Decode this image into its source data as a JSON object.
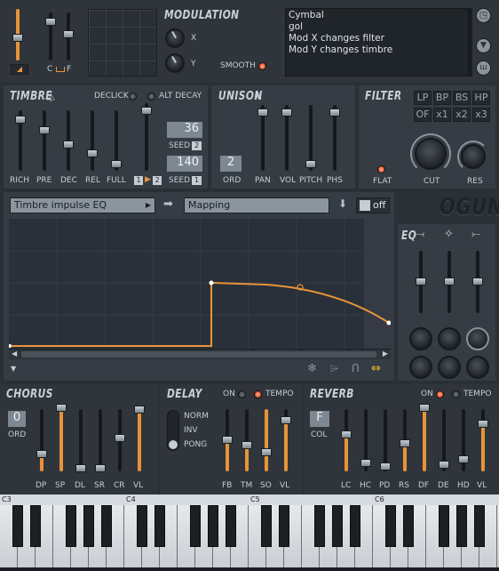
{
  "top": {
    "modulation_title": "MODULATION",
    "x_label": "X",
    "y_label": "Y",
    "smooth_label": "SMOOTH",
    "lfo_c": "C",
    "lfo_f": "F",
    "notes": [
      "Cymbal",
      "gol",
      "Mod X changes filter",
      "Mod Y changes timbre"
    ]
  },
  "timbre": {
    "title": "TIMBRE",
    "declick_label": "DECLICK",
    "alt_decay_label": "ALT DECAY",
    "sliders": [
      "RICH",
      "PRE",
      "DEC",
      "REL",
      "FULL"
    ],
    "seed_top_value": "36",
    "seed_top_label": "SEED",
    "seed_top_badge": "2",
    "seed_bottom_value": "140",
    "seed_bottom_label": "SEED",
    "seed_bottom_badge": "1",
    "page_a": "1",
    "page_b": "2"
  },
  "unison": {
    "title": "UNISON",
    "order_value": "2",
    "order_label": "ORD",
    "sliders": [
      "PAN",
      "VOL",
      "PITCH",
      "PHS"
    ]
  },
  "filter": {
    "title": "FILTER",
    "types_row1": [
      "LP",
      "BP",
      "BS",
      "HP"
    ],
    "types_row2": [
      "OF",
      "x1",
      "x2",
      "x3"
    ],
    "flat_label": "FLAT",
    "cut_label": "CUT",
    "res_label": "RES"
  },
  "editor": {
    "source_select": "Timbre impulse EQ",
    "target_select": "Mapping",
    "toggle_label": "off",
    "logo": "OGUN",
    "eq_title": "EQ"
  },
  "chorus": {
    "title": "CHORUS",
    "order_value": "0",
    "order_label": "ORD",
    "sliders": [
      "DP",
      "SP",
      "DL",
      "SR",
      "CR",
      "VL"
    ]
  },
  "delay": {
    "title": "DELAY",
    "on_label": "ON",
    "tempo_label": "TEMPO",
    "modes": [
      "NORM",
      "INV",
      "PONG"
    ],
    "sliders": [
      "FB",
      "TM",
      "SO",
      "VL"
    ]
  },
  "reverb": {
    "title": "REVERB",
    "on_label": "ON",
    "tempo_label": "TEMPO",
    "col_value": "F",
    "col_label": "COL",
    "sliders": [
      "LC",
      "HC",
      "PD",
      "RS",
      "DF",
      "DE",
      "HD",
      "VL"
    ]
  },
  "keyboard": {
    "octaves": [
      "C3",
      "C4",
      "C5",
      "C6"
    ]
  },
  "colors": {
    "accent": "#e8933a",
    "led_on": "#e8582e",
    "background": "#2a3036",
    "panel": "#353c43"
  }
}
